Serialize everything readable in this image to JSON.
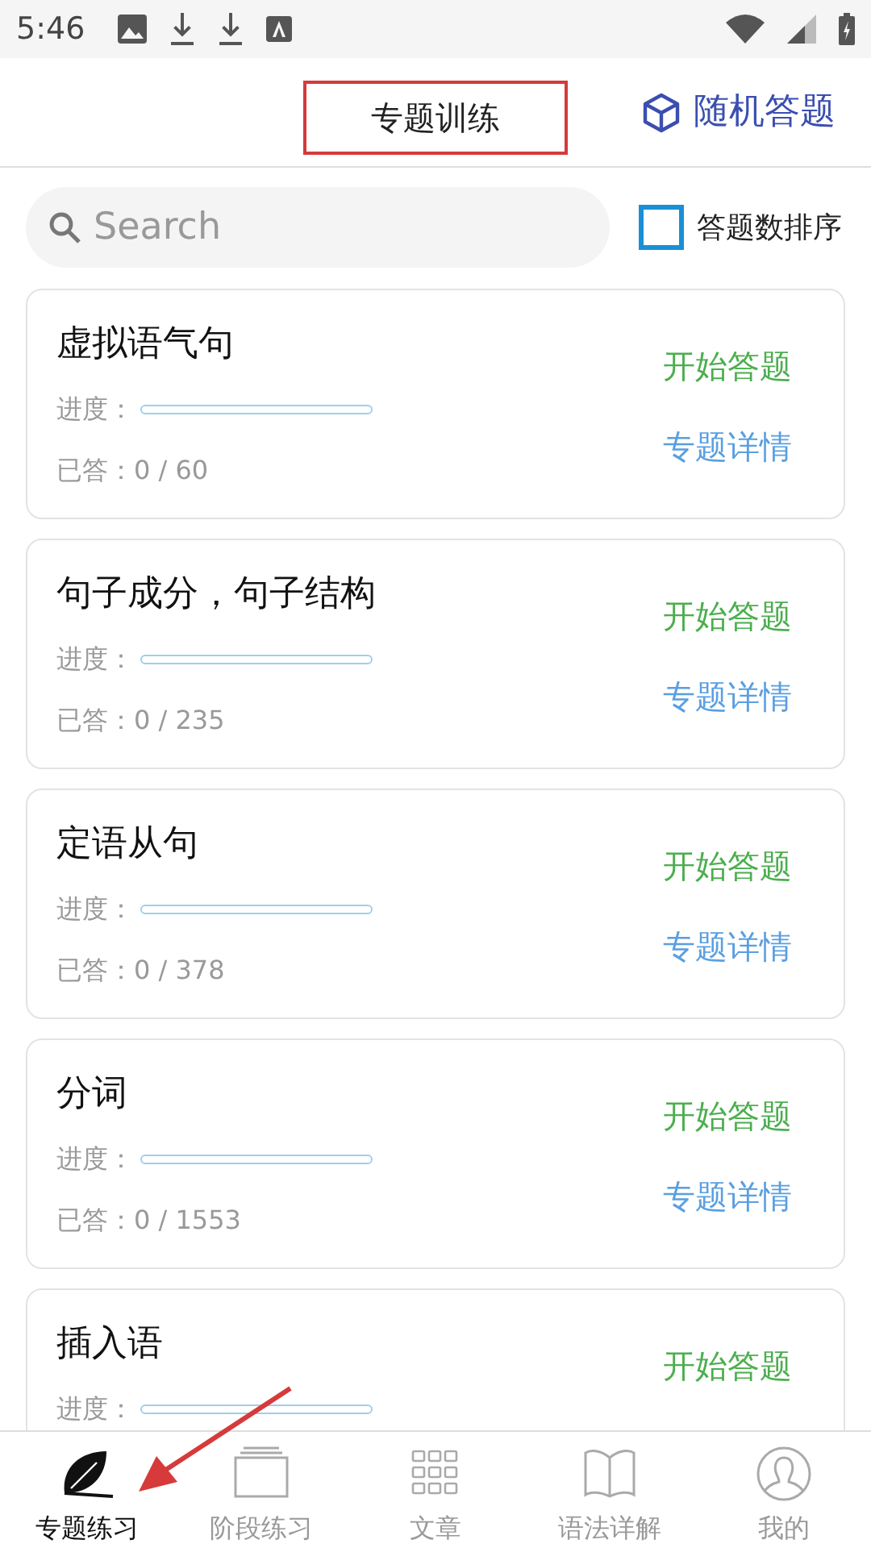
{
  "status_bar": {
    "time": "5:46"
  },
  "header": {
    "title": "专题训练",
    "title_highlighted": true,
    "random_button": "随机答题"
  },
  "search": {
    "placeholder": "Search"
  },
  "sort_checkbox": {
    "label": "答题数排序",
    "checked": false
  },
  "topics": [
    {
      "title": "虚拟语气句",
      "progress_label": "进度：",
      "level": 0,
      "answered": "已答：0 / 60",
      "start": "开始答题",
      "details": "专题详情"
    },
    {
      "title": "句子成分，句子结构",
      "progress_label": "进度：",
      "level": 0,
      "answered": "已答：0 / 235",
      "start": "开始答题",
      "details": "专题详情"
    },
    {
      "title": "定语从句",
      "progress_label": "进度：",
      "level": 0,
      "answered": "已答：0 / 378",
      "start": "开始答题",
      "details": "专题详情"
    },
    {
      "title": "分词",
      "progress_label": "进度：",
      "level": 0,
      "answered": "已答：0 / 1553",
      "start": "开始答题",
      "details": "专题详情"
    },
    {
      "title": "插入语",
      "progress_label": "进度：",
      "level": 0,
      "start": "开始答题"
    }
  ],
  "bottom_nav": [
    {
      "label": "专题练习",
      "kind": "leaf",
      "selected": true
    },
    {
      "label": "阶段练习",
      "kind": "stack",
      "selected": false
    },
    {
      "label": "文章",
      "kind": "grid",
      "selected": false
    },
    {
      "label": "语法详解",
      "kind": "book",
      "selected": false
    },
    {
      "label": "我的",
      "kind": "person",
      "selected": false
    }
  ],
  "pointer_arrow": true
}
